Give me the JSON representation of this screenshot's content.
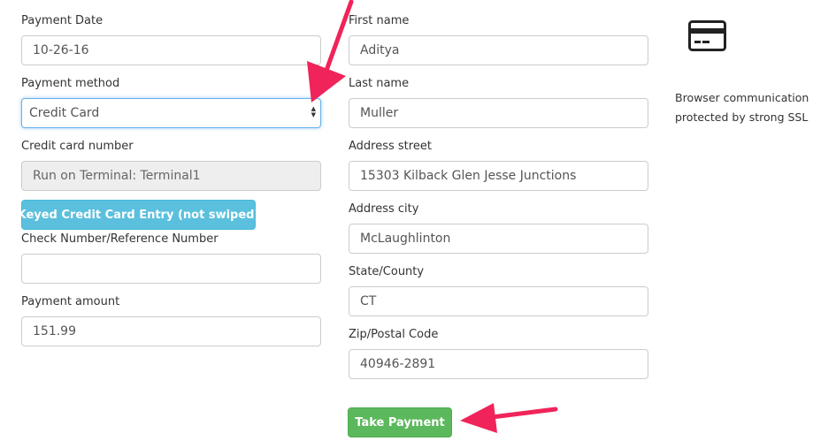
{
  "left": {
    "payment_date": {
      "label": "Payment Date",
      "value": "10-26-16"
    },
    "payment_method": {
      "label": "Payment method",
      "value": "Credit Card"
    },
    "card_number": {
      "label": "Credit card number",
      "value": "Run on Terminal: Terminal1"
    },
    "keyed_button": "Keyed Credit Card Entry (not swiped)",
    "check_number": {
      "label": "Check Number/Reference Number",
      "value": ""
    },
    "payment_amount": {
      "label": "Payment amount",
      "value": "151.99"
    }
  },
  "right": {
    "first_name": {
      "label": "First name",
      "value": "Aditya"
    },
    "last_name": {
      "label": "Last name",
      "value": "Muller"
    },
    "address_street": {
      "label": "Address street",
      "value": "15303 Kilback Glen Jesse Junctions"
    },
    "address_city": {
      "label": "Address city",
      "value": "McLaughlinton"
    },
    "state": {
      "label": "State/County",
      "value": "CT"
    },
    "zip": {
      "label": "Zip/Postal Code",
      "value": "40946-2891"
    },
    "take_payment_button": "Take Payment"
  },
  "aside": {
    "icon": "credit-card-icon",
    "line1": "Browser communication",
    "line2": "protected by strong SSL"
  },
  "colors": {
    "annotation_arrow": "#f0245a",
    "info_button": "#5bc0de",
    "success_button": "#5cb85c"
  }
}
